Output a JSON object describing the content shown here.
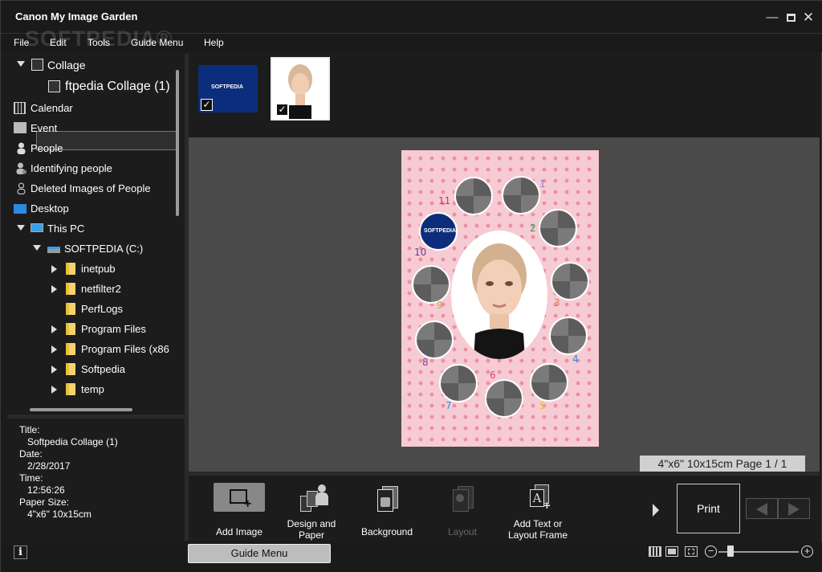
{
  "window": {
    "title": "Canon My Image Garden",
    "watermark": "SOFTPEDIA®"
  },
  "menu": [
    "File",
    "Edit",
    "Tools",
    "Guide Menu",
    "Help"
  ],
  "tree": {
    "collage": "Collage",
    "collage_item": "ftpedia Collage (1)",
    "calendar": "Calendar",
    "event": "Event",
    "people": "People",
    "identifying": "Identifying people",
    "deleted": "Deleted Images of People",
    "desktop": "Desktop",
    "this_pc": "This PC",
    "drive": "SOFTPEDIA (C:)",
    "folders": [
      "inetpub",
      "netfilter2",
      "PerfLogs",
      "Program Files",
      "Program Files (x86",
      "Softpedia",
      "temp"
    ]
  },
  "info": {
    "title_label": "Title:",
    "title_value": "Softpedia Collage (1)",
    "date_label": "Date:",
    "date_value": "2/28/2017",
    "time_label": "Time:",
    "time_value": "12:56:26",
    "paper_label": "Paper Size:",
    "paper_value": "4\"x6\" 10x15cm"
  },
  "thumbs": {
    "logo_text": "SOFTPEDIA",
    "check": "✓"
  },
  "canvas": {
    "slot_logo_text": "SOFTPEDIA",
    "numbers": [
      "1",
      "2",
      "3",
      "4",
      "5",
      "6",
      "7",
      "8",
      "9",
      "10",
      "11"
    ],
    "page_indicator": "4\"x6\" 10x15cm Page 1 / 1"
  },
  "toolbar": {
    "add_image": "Add Image",
    "design_paper_1": "Design and",
    "design_paper_2": "Paper",
    "background": "Background",
    "layout": "Layout",
    "add_text_1": "Add Text or",
    "add_text_2": "Layout Frame",
    "print": "Print"
  },
  "status": {
    "info": "i",
    "guide_menu": "Guide Menu",
    "zoom_out": "−",
    "zoom_in": "+"
  },
  "colors": {
    "paper_pink": "#f7cbd3",
    "dot_pink": "#eb8fa4",
    "logo_blue": "#0b2d7c"
  }
}
